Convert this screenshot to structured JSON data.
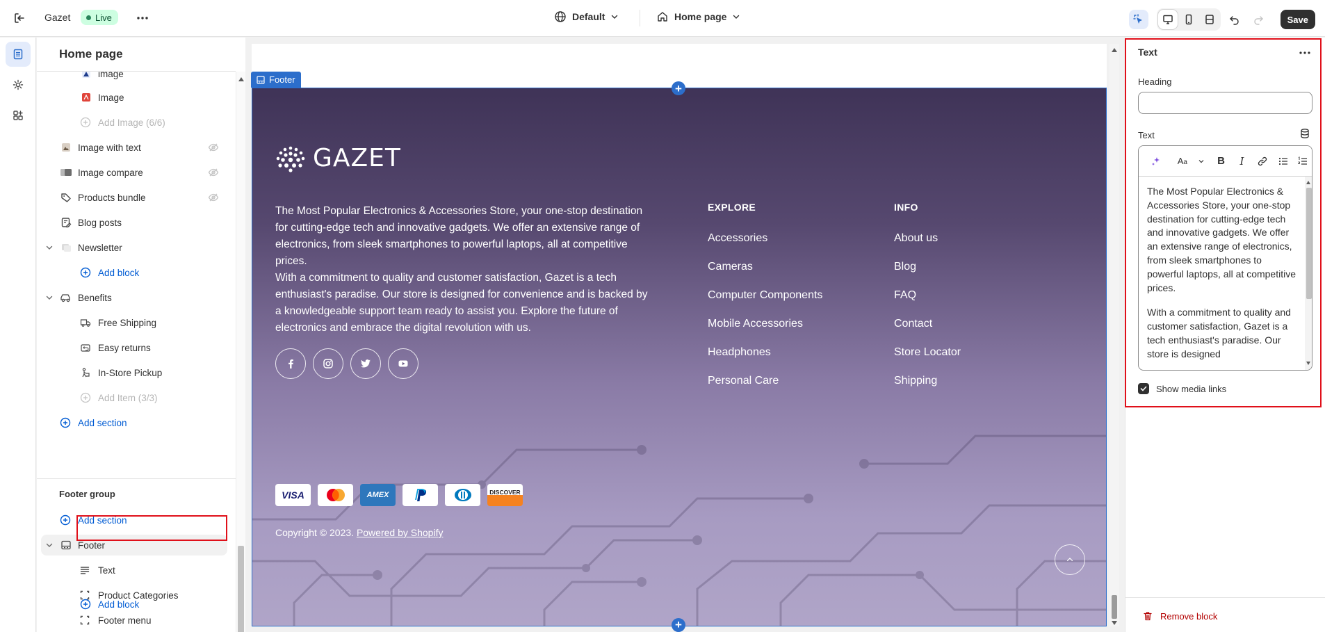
{
  "topbar": {
    "store_name": "Gazet",
    "status_badge": "Live",
    "theme_selector": "Default",
    "page_selector": "Home page",
    "save_label": "Save"
  },
  "sidebar": {
    "title": "Home page",
    "items": [
      {
        "label": "image",
        "icon": "image-thumb-icon"
      },
      {
        "label": "Image",
        "icon": "image-thumb-icon"
      },
      {
        "label": "Add Image (6/6)",
        "icon": "plus-circle-icon"
      },
      {
        "label": "Image with text",
        "icon": "image-thumb-icon"
      },
      {
        "label": "Image compare",
        "icon": "image-compare-icon"
      },
      {
        "label": "Products bundle",
        "icon": "tag-icon"
      },
      {
        "label": "Blog posts",
        "icon": "edit-icon"
      },
      {
        "label": "Newsletter",
        "icon": "section-icon"
      },
      {
        "label": "Add block",
        "icon": "plus-circle-icon"
      },
      {
        "label": "Benefits",
        "icon": "car-icon"
      },
      {
        "label": "Free Shipping",
        "icon": "truck-icon"
      },
      {
        "label": "Easy returns",
        "icon": "return-icon"
      },
      {
        "label": "In-Store Pickup",
        "icon": "person-icon"
      },
      {
        "label": "Add Item (3/3)",
        "icon": "plus-circle-icon"
      },
      {
        "label": "Add section",
        "icon": "plus-circle-icon"
      }
    ],
    "footer_group_label": "Footer group",
    "footer_add_section": "Add section",
    "footer_items": [
      {
        "label": "Footer",
        "icon": "footer-icon"
      },
      {
        "label": "Text",
        "icon": "text-lines-icon"
      },
      {
        "label": "Product Categories",
        "icon": "block-icon"
      },
      {
        "label": "Footer menu",
        "icon": "block-icon"
      },
      {
        "label": "Add block",
        "icon": "plus-circle-icon"
      }
    ]
  },
  "canvas": {
    "section_tag": "Footer",
    "logo_text": "GAZET",
    "description_1": "The Most Popular Electronics & Accessories Store, your one-stop destination for cutting-edge tech and innovative gadgets. We offer an extensive range of electronics, from sleek smartphones to powerful laptops, all at competitive prices.",
    "description_2": "With a commitment to quality and customer satisfaction, Gazet is a tech enthusiast's paradise. Our store is designed for convenience and is backed by a knowledgeable support team ready to assist you. Explore the future of electronics and embrace the digital revolution with us.",
    "social": [
      "facebook-icon",
      "instagram-icon",
      "twitter-icon",
      "youtube-icon"
    ],
    "explore": {
      "heading": "EXPLORE",
      "links": [
        "Accessories",
        "Cameras",
        "Computer Components",
        "Mobile Accessories",
        "Headphones",
        "Personal Care"
      ]
    },
    "info": {
      "heading": "INFO",
      "links": [
        "About us",
        "Blog",
        "FAQ",
        "Contact",
        "Store Locator",
        "Shipping"
      ]
    },
    "payments": [
      "VISA",
      "Mastercard",
      "AMEX",
      "PayPal",
      "Diners",
      "DISCOVER"
    ],
    "copyright": "Copyright © 2023.",
    "powered_by": "Powered by Shopify"
  },
  "panel": {
    "title": "Text",
    "heading_label": "Heading",
    "heading_value": "",
    "text_label": "Text",
    "text_p1": "The Most Popular Electronics & Accessories Store, your one-stop destination for cutting-edge tech and innovative gadgets. We offer an extensive range of electronics, from sleek smartphones to powerful laptops, all at competitive prices.",
    "text_p2": "With a commitment to quality and customer satisfaction, Gazet is a tech enthusiast's paradise. Our store is designed",
    "show_media_label": "Show media links",
    "show_media_checked": true,
    "remove_label": "Remove block"
  },
  "colors": {
    "accent": "#2c6ecb",
    "highlight": "#e0101a",
    "danger": "#b30000"
  }
}
